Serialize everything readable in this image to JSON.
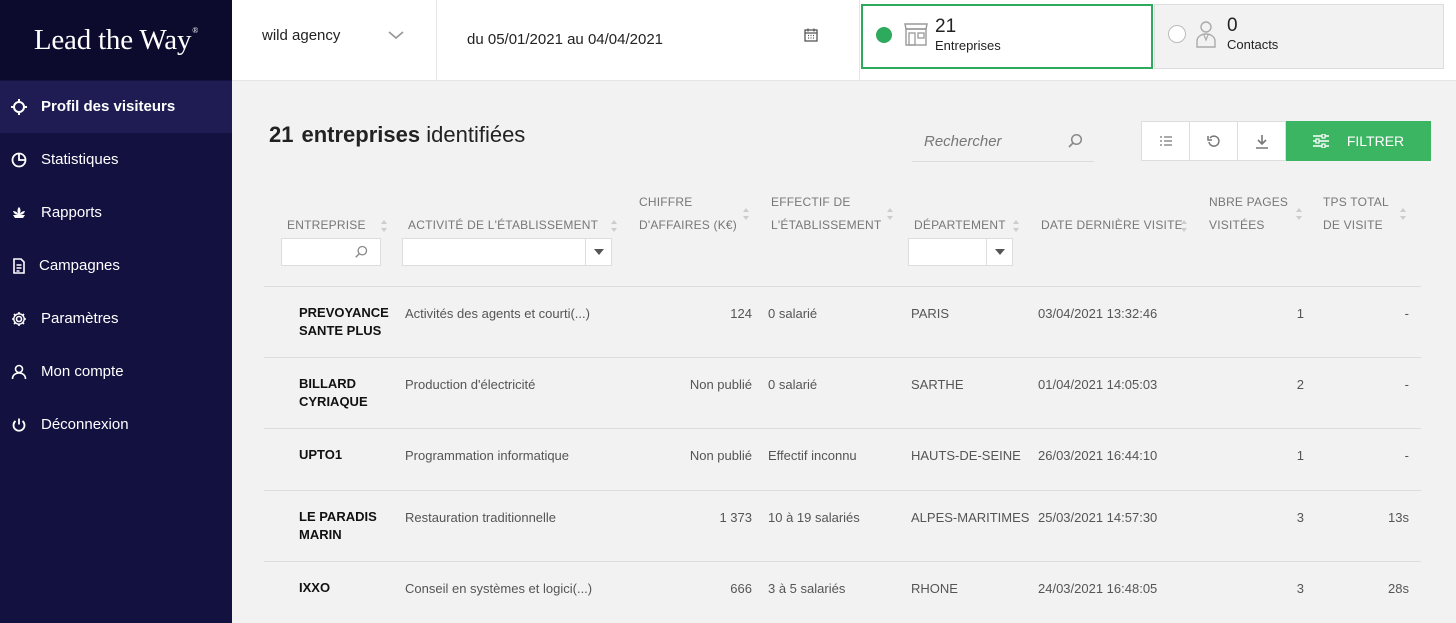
{
  "logo": {
    "text": "Lead the Way",
    "mark": "®"
  },
  "sidebar": {
    "items": [
      {
        "label": "Profil des visiteurs",
        "icon": "crosshair-icon",
        "active": true
      },
      {
        "label": "Statistiques",
        "icon": "pie-chart-icon"
      },
      {
        "label": "Rapports",
        "icon": "lotus-icon"
      },
      {
        "label": "Campagnes",
        "icon": "document-icon"
      },
      {
        "label": "Paramètres",
        "icon": "gear-icon"
      },
      {
        "label": "Mon compte",
        "icon": "user-icon"
      },
      {
        "label": "Déconnexion",
        "icon": "power-icon"
      }
    ]
  },
  "topbar": {
    "agency": "wild agency",
    "date_range": "du 05/01/2021 au 04/04/2021",
    "cards": {
      "entreprises": {
        "count": "21",
        "label": "Entreprises",
        "icon": "storefront-icon"
      },
      "contacts": {
        "count": "0",
        "label": "Contacts",
        "icon": "person-icon"
      }
    }
  },
  "main": {
    "count": "21",
    "title_bold": "entreprises",
    "title_rest": "identifiées",
    "search_placeholder": "Rechercher",
    "filter_label": "FILTRER"
  },
  "table": {
    "columns": [
      {
        "line1": "ENTREPRISE",
        "line2": ""
      },
      {
        "line1": "ACTIVITÉ DE L'ÉTABLISSEMENT",
        "line2": ""
      },
      {
        "line1": "CHIFFRE",
        "line2": "D'AFFAIRES (K€)"
      },
      {
        "line1": "EFFECTIF DE",
        "line2": "L'ÉTABLISSEMENT"
      },
      {
        "line1": "DÉPARTEMENT",
        "line2": ""
      },
      {
        "line1": "DATE DERNIÈRE VISITE",
        "line2": ""
      },
      {
        "line1": "NBRE PAGES",
        "line2": "VISITÉES"
      },
      {
        "line1": "TPS TOTAL",
        "line2": "DE VISITE"
      }
    ],
    "rows": [
      {
        "name": "PREVOYANCE SANTE PLUS",
        "activity": "Activités des agents et courti(...)",
        "ca": "124",
        "effectif": "0 salarié",
        "dept": "PARIS",
        "date": "03/04/2021 13:32:46",
        "pages": "1",
        "duration": "-"
      },
      {
        "name": "BILLARD CYRIAQUE",
        "activity": "Production d'électricité",
        "ca": "Non publié",
        "effectif": "0 salarié",
        "dept": "SARTHE",
        "date": "01/04/2021 14:05:03",
        "pages": "2",
        "duration": "-"
      },
      {
        "name": "UPTO1",
        "activity": "Programmation informatique",
        "ca": "Non publié",
        "effectif": "Effectif inconnu",
        "dept": "HAUTS-DE-SEINE",
        "date": "26/03/2021 16:44:10",
        "pages": "1",
        "duration": "-"
      },
      {
        "name": "LE PARADIS MARIN",
        "activity": "Restauration traditionnelle",
        "ca": "1 373",
        "effectif": "10 à 19 salariés",
        "dept": "ALPES-MARITIMES",
        "date": "25/03/2021 14:57:30",
        "pages": "3",
        "duration": "13s"
      },
      {
        "name": "IXXO",
        "activity": "Conseil en systèmes et logici(...)",
        "ca": "666",
        "effectif": "3 à 5 salariés",
        "dept": "RHONE",
        "date": "24/03/2021 16:48:05",
        "pages": "3",
        "duration": "28s"
      }
    ]
  }
}
